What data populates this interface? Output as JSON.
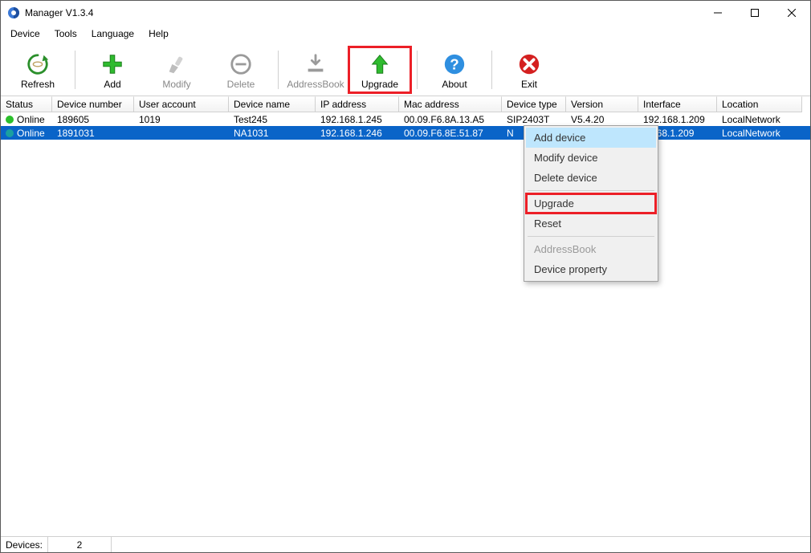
{
  "window": {
    "title": "Manager V1.3.4"
  },
  "menubar": [
    "Device",
    "Tools",
    "Language",
    "Help"
  ],
  "toolbar": {
    "refresh": "Refresh",
    "add": "Add",
    "modify": "Modify",
    "delete": "Delete",
    "addressbook": "AddressBook",
    "upgrade": "Upgrade",
    "about": "About",
    "exit": "Exit"
  },
  "columns": [
    "Status",
    "Device number",
    "User account",
    "Device name",
    "IP address",
    "Mac address",
    "Device type",
    "Version",
    "Interface",
    "Location"
  ],
  "rows": [
    {
      "status": "Online",
      "status_color": "#2bbf2b",
      "device_number": "189605",
      "user_account": "1019",
      "device_name": "Test245",
      "ip": "192.168.1.245",
      "mac": "00.09.F6.8A.13.A5",
      "device_type": "SIP2403T",
      "version": "V5.4.20",
      "interface": "192.168.1.209",
      "location": "LocalNetwork",
      "selected": false
    },
    {
      "status": "Online",
      "status_color": "#1aa0a0",
      "device_number": "1891031",
      "user_account": "",
      "device_name": "NA1031",
      "ip": "192.168.1.246",
      "mac": "00.09.F6.8E.51.87",
      "device_type": "N",
      "version": "",
      "interface": "2.168.1.209",
      "location": "LocalNetwork",
      "selected": true
    }
  ],
  "context_menu": {
    "add_device": "Add device",
    "modify_device": "Modify device",
    "delete_device": "Delete device",
    "upgrade": "Upgrade",
    "reset": "Reset",
    "addressbook": "AddressBook",
    "device_property": "Device property"
  },
  "statusbar": {
    "label": "Devices:",
    "count": "2"
  }
}
